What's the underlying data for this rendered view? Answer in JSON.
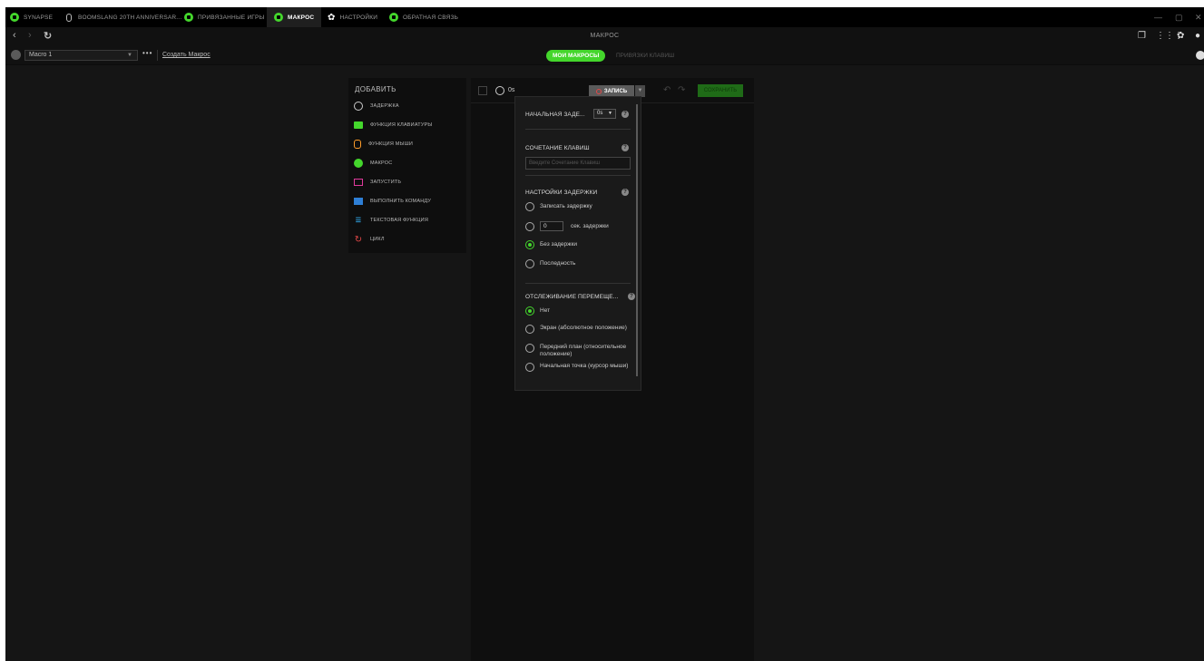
{
  "tabs": [
    {
      "label": "SYNAPSE"
    },
    {
      "label": "BOOMSLANG 20TH ANNIVERSAR..."
    },
    {
      "label": "ПРИВЯЗАННЫЕ ИГРЫ"
    },
    {
      "label": "МАКРОС"
    },
    {
      "label": "НАСТРОЙКИ"
    },
    {
      "label": "ОБРАТНАЯ СВЯЗЬ"
    }
  ],
  "nav": {
    "title": "МАКРОС"
  },
  "profile": {
    "selected": "Macro 1",
    "create_link": "Создать Макрос",
    "subtabs": {
      "active": "МОИ МАКРОСЫ",
      "inactive": "ПРИВЯЗКИ КЛАВИШ"
    }
  },
  "add_panel": {
    "title": "ДОБАВИТЬ",
    "items": [
      {
        "label": "ЗАДЕРЖКА"
      },
      {
        "label": "ФУНКЦИЯ КЛАВИАТУРЫ"
      },
      {
        "label": "ФУНКЦИЯ МЫШИ"
      },
      {
        "label": "МАКРОС"
      },
      {
        "label": "ЗАПУСТИТЬ"
      },
      {
        "label": "ВЫПОЛНИТЬ КОМАНДУ"
      },
      {
        "label": "ТЕКСТОВАЯ ФУНКЦИЯ"
      },
      {
        "label": "ЦИКЛ"
      }
    ]
  },
  "editor": {
    "time": "0s",
    "record_label": "ЗАПИСЬ",
    "save_label": "СОХРАНИТЬ"
  },
  "dropdown": {
    "initial_delay_label": "НАЧАЛЬНАЯ ЗАДЕ...",
    "initial_delay_value": "0s",
    "hotkey_label": "СОЧЕТАНИЕ КЛАВИШ",
    "hotkey_placeholder": "Введите Сочетание Клавиш",
    "delay_settings_label": "НАСТРОЙКИ ЗАДЕРЖКИ",
    "delay_options": [
      {
        "label": "Записать задержку",
        "selected": false
      },
      {
        "label": "сек. задержки",
        "value": "0",
        "selected": false
      },
      {
        "label": "Без задержки",
        "selected": true
      },
      {
        "label": "Последность",
        "selected": false
      }
    ],
    "tracking_label": "ОТСЛЕЖИВАНИЕ ПЕРЕМЕЩЕ...",
    "tracking_options": [
      {
        "label": "Нет",
        "selected": true
      },
      {
        "label": "Экран (абсолютное положение)",
        "selected": false
      },
      {
        "label": "Передний план (относительное положение)",
        "selected": false
      },
      {
        "label": "Начальная точка (курсор мыши)",
        "selected": false
      }
    ]
  },
  "colors": {
    "accent": "#44d62c",
    "background": "#151515",
    "titlebar": "#000000"
  }
}
